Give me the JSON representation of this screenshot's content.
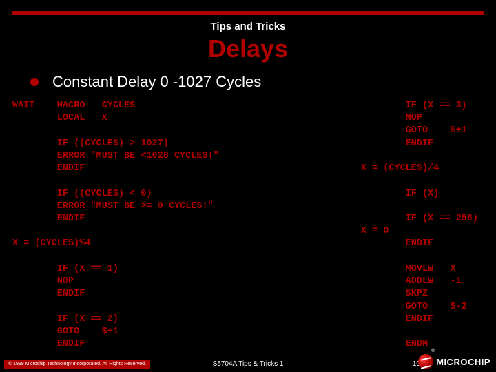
{
  "header": {
    "section": "Tips and Tricks",
    "title": "Delays"
  },
  "bullet": {
    "text": "Constant Delay 0 -1027 Cycles"
  },
  "code": {
    "left": "WAIT    MACRO   CYCLES\n        LOCAL   X\n\n        IF ((CYCLES) > 1027)\n        ERROR \"MUST BE <1028 CYCLES!\"\n        ENDIF\n\n        IF ((CYCLES) < 0)\n        ERROR \"MUST BE >= 0 CYCLES!\"\n        ENDIF\n\nX = (CYCLES)%4\n\n        IF (X == 1)\n        NOP\n        ENDIF\n\n        IF (X == 2)\n        GOTO    $+1\n        ENDIF",
    "right": "        IF (X == 3)\n        NOP\n        GOTO    $+1\n        ENDIF\n\nX = (CYCLES)/4\n\n        IF (X)\n\n        IF (X == 256)\nX = 0\n        ENDIF\n\n        MOVLW   X\n        ADDLW   -1\n        SKPZ\n        GOTO    $-2\n        ENDIF\n\n        ENDM"
  },
  "footer": {
    "copyright": "© 1999 Microchip Technology Incorporated. All Rights Reserved.",
    "center": "S5704A Tips & Tricks  1",
    "page": "10",
    "logo_text": "MICROCHIP",
    "reg": "®"
  }
}
